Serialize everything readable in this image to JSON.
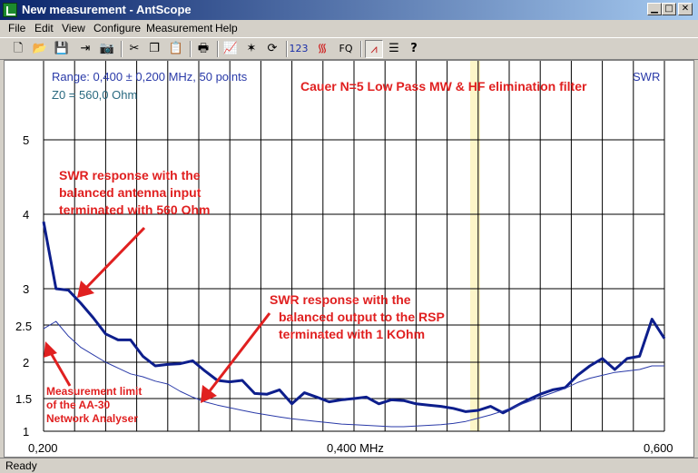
{
  "window": {
    "title": "New measurement - AntScope"
  },
  "menu": [
    "File",
    "Edit",
    "View",
    "Configure",
    "Measurement",
    "Help"
  ],
  "toolbar": {
    "items": [
      {
        "name": "new-file-icon",
        "glyph": "🗋"
      },
      {
        "name": "open-folder-icon",
        "glyph": "📂"
      },
      {
        "name": "save-icon",
        "glyph": "💾"
      },
      {
        "name": "export-icon",
        "glyph": "⇥"
      },
      {
        "name": "camera-icon",
        "glyph": "📷"
      },
      {
        "name": "cut-icon",
        "glyph": "✂"
      },
      {
        "name": "copy-icon",
        "glyph": "❐"
      },
      {
        "name": "paste-icon",
        "glyph": "📋"
      },
      {
        "name": "print-icon",
        "glyph": "🖶"
      },
      {
        "name": "graph-icon",
        "glyph": "📈"
      },
      {
        "name": "settings-star-icon",
        "glyph": "✶"
      },
      {
        "name": "refresh-icon",
        "glyph": "⟳"
      },
      {
        "name": "numbers-icon",
        "glyph": "123"
      },
      {
        "name": "antenna-icon",
        "glyph": "᯾"
      },
      {
        "name": "fq-icon",
        "glyph": "FQ"
      },
      {
        "name": "chart-mode-icon",
        "glyph": "⩘"
      },
      {
        "name": "table-icon",
        "glyph": "☰"
      },
      {
        "name": "help-icon",
        "glyph": "?"
      }
    ]
  },
  "status": {
    "text": "Ready"
  },
  "colors": {
    "thick": "#0d1e8c",
    "thin": "#2a3aa8",
    "annot": "#e02020",
    "marker": "#fdf6c8"
  },
  "chart_data": {
    "type": "line",
    "title": "Cauer N=5 Low Pass MW & HF elimination filter",
    "range_text": "Range: 0,400 ± 0,200 MHz, 50 points",
    "z0_text": "Z0 = 560,0 Ohm",
    "ylabel": "SWR",
    "x_ticks": [
      "0,200",
      "0,400 MHz",
      "0,600"
    ],
    "y_ticks": [
      "5",
      "4",
      "3",
      "2.5",
      "2",
      "1.5",
      "1"
    ],
    "xlim": [
      0.2,
      0.6
    ],
    "marker_x": 0.47,
    "annotations": [
      "SWR response with the",
      "balanced antenna input",
      "terminated with 560 Ohm",
      "SWR response with the",
      "balanced output to the RSP",
      "terminated with 1 KOhm",
      "Measurement limit",
      "of the AA-30",
      "Network Analyser"
    ],
    "series": [
      {
        "x": [
          0.2,
          0.208,
          0.216,
          0.224,
          0.232,
          0.24,
          0.248,
          0.256,
          0.264,
          0.272,
          0.28,
          0.288,
          0.296,
          0.304,
          0.312,
          0.32,
          0.328,
          0.336,
          0.344,
          0.352,
          0.36,
          0.368,
          0.376,
          0.384,
          0.392,
          0.4,
          0.408,
          0.416,
          0.424,
          0.432,
          0.44,
          0.448,
          0.456,
          0.464,
          0.472,
          0.48,
          0.488,
          0.496,
          0.504,
          0.512,
          0.52,
          0.528,
          0.536,
          0.544,
          0.552,
          0.56,
          0.568,
          0.576,
          0.584,
          0.592,
          0.6
        ],
        "values": [
          3.9,
          3.0,
          2.98,
          2.8,
          2.6,
          2.38,
          2.3,
          2.3,
          2.08,
          1.95,
          1.97,
          1.98,
          2.02,
          1.88,
          1.75,
          1.73,
          1.75,
          1.57,
          1.56,
          1.62,
          1.42,
          1.58,
          1.52,
          1.45,
          1.48,
          1.5,
          1.52,
          1.42,
          1.48,
          1.47,
          1.42,
          1.4,
          1.38,
          1.35,
          1.3,
          1.32,
          1.38,
          1.28,
          1.38,
          1.48,
          1.56,
          1.62,
          1.65,
          1.82,
          1.95,
          2.05,
          1.9,
          2.05,
          2.08,
          2.58,
          2.32
        ]
      },
      {
        "x": [
          0.2,
          0.208,
          0.216,
          0.224,
          0.232,
          0.24,
          0.248,
          0.256,
          0.264,
          0.272,
          0.28,
          0.288,
          0.296,
          0.304,
          0.312,
          0.32,
          0.328,
          0.336,
          0.344,
          0.352,
          0.36,
          0.368,
          0.376,
          0.384,
          0.392,
          0.4,
          0.408,
          0.416,
          0.424,
          0.432,
          0.44,
          0.448,
          0.456,
          0.464,
          0.472,
          0.48,
          0.488,
          0.496,
          0.504,
          0.512,
          0.52,
          0.528,
          0.536,
          0.544,
          0.552,
          0.56,
          0.568,
          0.576,
          0.584,
          0.592,
          0.6
        ],
        "values": [
          2.45,
          2.55,
          2.35,
          2.2,
          2.1,
          2.0,
          1.92,
          1.84,
          1.8,
          1.74,
          1.7,
          1.6,
          1.52,
          1.45,
          1.4,
          1.36,
          1.32,
          1.28,
          1.25,
          1.22,
          1.19,
          1.17,
          1.15,
          1.13,
          1.11,
          1.1,
          1.09,
          1.08,
          1.07,
          1.07,
          1.08,
          1.09,
          1.1,
          1.12,
          1.15,
          1.2,
          1.25,
          1.31,
          1.38,
          1.45,
          1.52,
          1.58,
          1.64,
          1.72,
          1.78,
          1.82,
          1.86,
          1.88,
          1.9,
          1.95,
          1.95
        ]
      }
    ]
  }
}
